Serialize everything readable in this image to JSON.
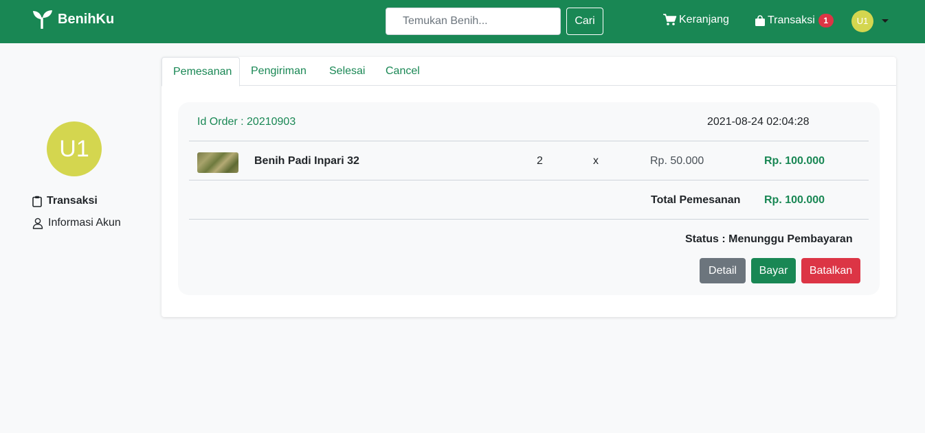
{
  "navbar": {
    "brand": "BenihKu",
    "search_placeholder": "Temukan Benih...",
    "search_button": "Cari",
    "cart_label": "Keranjang",
    "transaction_label": "Transaksi",
    "transaction_count": "1",
    "avatar_initials": "U1"
  },
  "sidebar": {
    "avatar_initials": "U1",
    "items": [
      {
        "label": "Transaksi",
        "icon": "clipboard-icon"
      },
      {
        "label": "Informasi Akun",
        "icon": "user-icon"
      }
    ]
  },
  "tabs": [
    {
      "label": "Pemesanan",
      "active": true
    },
    {
      "label": "Pengiriman",
      "active": false
    },
    {
      "label": "Selesai",
      "active": false
    },
    {
      "label": "Cancel",
      "active": false
    }
  ],
  "order": {
    "id_text": "Id Order : 20210903",
    "date": "2021-08-24 02:04:28",
    "items": [
      {
        "name": "Benih Padi Inpari 32",
        "quantity": "2",
        "times": "x",
        "price": "Rp. 50.000",
        "subtotal": "Rp. 100.000"
      }
    ],
    "total_label": "Total Pemesanan",
    "total_value": "Rp. 100.000",
    "status": "Status : Menunggu Pembayaran",
    "buttons": {
      "detail": "Detail",
      "pay": "Bayar",
      "cancel": "Batalkan"
    }
  },
  "colors": {
    "primary": "#198754",
    "danger": "#dc3545",
    "secondary": "#6c757d",
    "avatar": "#d4d64f"
  }
}
